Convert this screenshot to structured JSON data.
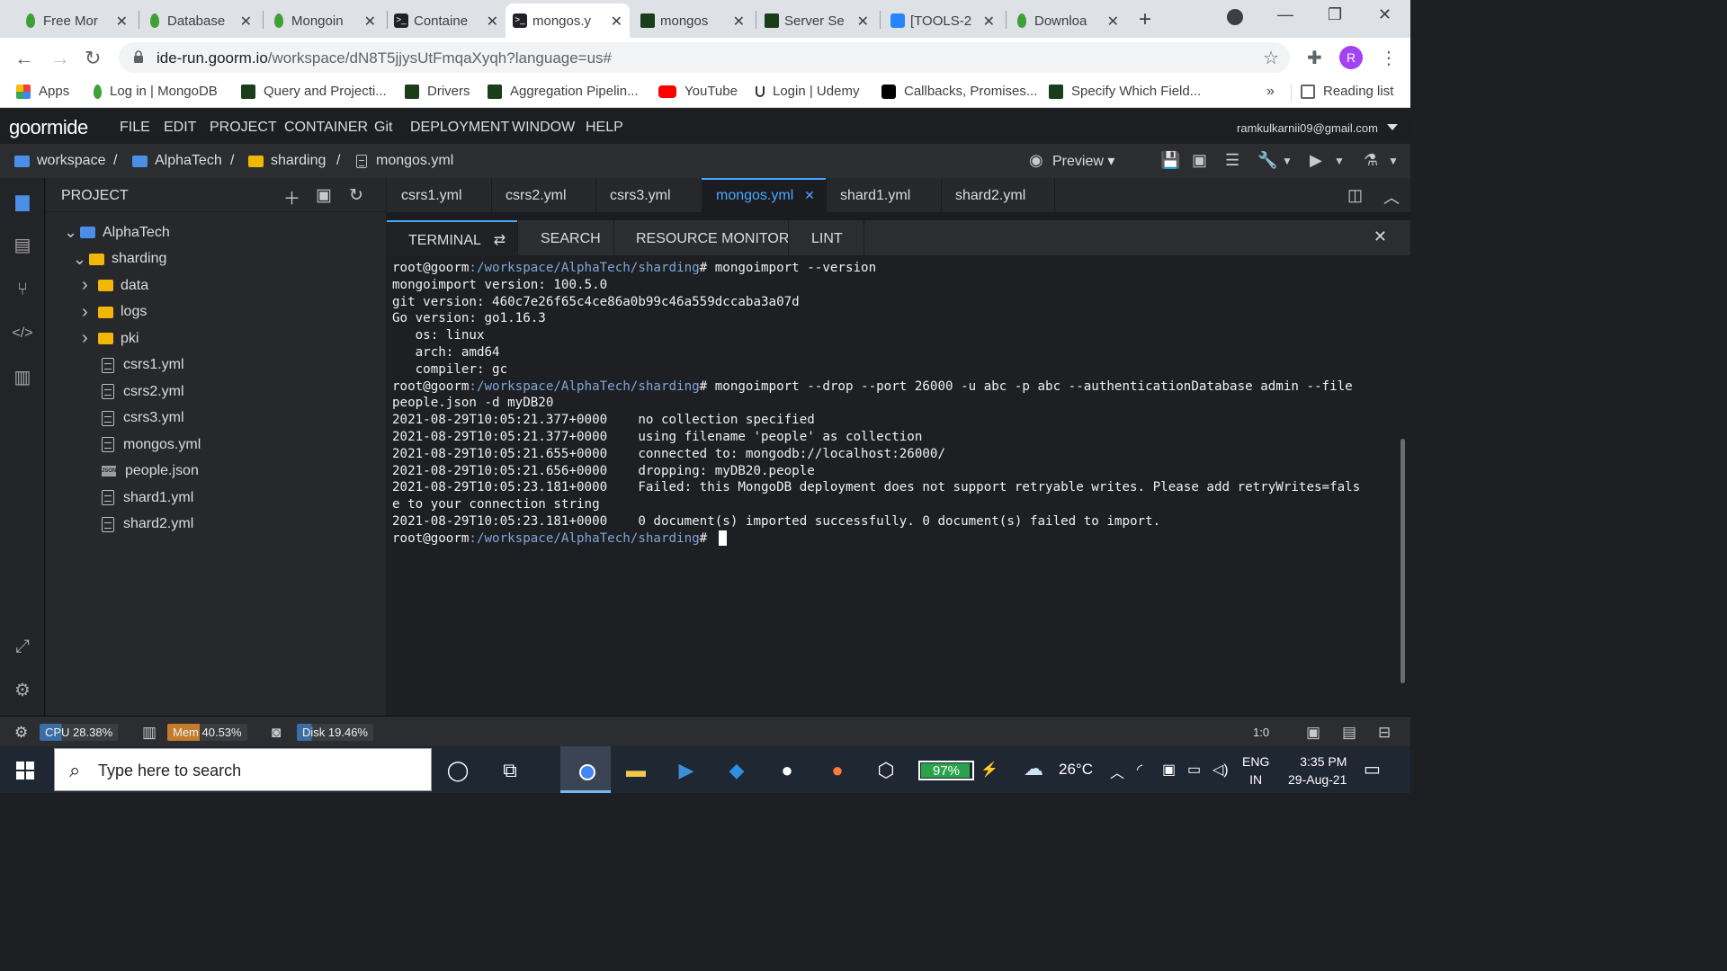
{
  "browser": {
    "tabs": [
      {
        "title": "Free Mor",
        "icon": "mongodb-leaf-icon"
      },
      {
        "title": "Database",
        "icon": "mongodb-leaf-icon"
      },
      {
        "title": "Mongoin",
        "icon": "mongodb-leaf-icon"
      },
      {
        "title": "Containe",
        "icon": "terminal-icon"
      },
      {
        "title": "mongos.y",
        "icon": "terminal-icon",
        "active": true
      },
      {
        "title": "mongos",
        "icon": "mongodb-university-icon"
      },
      {
        "title": "Server Se",
        "icon": "mongodb-university-icon"
      },
      {
        "title": "[TOOLS-2",
        "icon": "jira-icon"
      },
      {
        "title": "Downloa",
        "icon": "mongodb-leaf-icon"
      }
    ],
    "url_host": "ide-run.goorm.io",
    "url_path": "/workspace/dN8T5jjysUtFmqaXyqh?language=us#",
    "profile_initial": "R",
    "bookmarks": [
      {
        "label": "Apps",
        "icon": "apps-icon"
      },
      {
        "label": "Log in | MongoDB",
        "icon": "mongodb-leaf-icon"
      },
      {
        "label": "Query and Projecti...",
        "icon": "mongodb-university-icon"
      },
      {
        "label": "Drivers",
        "icon": "mongodb-university-icon"
      },
      {
        "label": "Aggregation Pipelin...",
        "icon": "mongodb-university-icon"
      },
      {
        "label": "YouTube",
        "icon": "youtube-icon"
      },
      {
        "label": "Login | Udemy",
        "icon": "udemy-icon"
      },
      {
        "label": "Callbacks, Promises...",
        "icon": "medium-icon"
      },
      {
        "label": "Specify Which Field...",
        "icon": "mongodb-university-icon"
      }
    ],
    "more_bookmarks": "»",
    "reading_list": "Reading list"
  },
  "ide": {
    "logo": "goormide",
    "menu": [
      "FILE",
      "EDIT",
      "PROJECT",
      "CONTAINER",
      "Git",
      "DEPLOYMENT",
      "WINDOW",
      "HELP"
    ],
    "user": "ramkulkarnii09@gmail.com",
    "breadcrumb": [
      "workspace",
      "AlphaTech",
      "sharding",
      "mongos.yml"
    ],
    "preview_label": "Preview",
    "project_title": "PROJECT",
    "tree": [
      {
        "label": "AlphaTech",
        "type": "project",
        "depth": 0,
        "expanded": true
      },
      {
        "label": "sharding",
        "type": "folder-open",
        "depth": 1,
        "expanded": true
      },
      {
        "label": "data",
        "type": "folder",
        "depth": 2
      },
      {
        "label": "logs",
        "type": "folder",
        "depth": 2
      },
      {
        "label": "pki",
        "type": "folder",
        "depth": 2
      },
      {
        "label": "csrs1.yml",
        "type": "file",
        "depth": 2
      },
      {
        "label": "csrs2.yml",
        "type": "file",
        "depth": 2
      },
      {
        "label": "csrs3.yml",
        "type": "file",
        "depth": 2
      },
      {
        "label": "mongos.yml",
        "type": "file",
        "depth": 2
      },
      {
        "label": "people.json",
        "type": "json",
        "depth": 2
      },
      {
        "label": "shard1.yml",
        "type": "file",
        "depth": 2
      },
      {
        "label": "shard2.yml",
        "type": "file",
        "depth": 2
      }
    ],
    "editor_tabs": [
      {
        "label": "csrs1.yml"
      },
      {
        "label": "csrs2.yml"
      },
      {
        "label": "csrs3.yml"
      },
      {
        "label": "mongos.yml",
        "active": true
      },
      {
        "label": "shard1.yml"
      },
      {
        "label": "shard2.yml"
      }
    ],
    "panel_tabs": [
      "TERMINAL",
      "SEARCH",
      "RESOURCE MONITOR",
      "LINT"
    ],
    "terminal": {
      "prompt_user": "root@goorm",
      "prompt_path": ":/workspace/AlphaTech/sharding",
      "prompt_sym": "# ",
      "lines": [
        {
          "prompt": true,
          "text": "mongoimport --version"
        },
        {
          "text": "mongoimport version: 100.5.0"
        },
        {
          "text": "git version: 460c7e26f65c4ce86a0b99c46a559dccaba3a07d"
        },
        {
          "text": "Go version: go1.16.3"
        },
        {
          "text": "   os: linux"
        },
        {
          "text": "   arch: amd64"
        },
        {
          "text": "   compiler: gc"
        },
        {
          "prompt": true,
          "text": "mongoimport --drop --port 26000 -u abc -p abc --authenticationDatabase admin --file"
        },
        {
          "text": "people.json -d myDB20"
        },
        {
          "text": "2021-08-29T10:05:21.377+0000    no collection specified"
        },
        {
          "text": "2021-08-29T10:05:21.377+0000    using filename 'people' as collection"
        },
        {
          "text": "2021-08-29T10:05:21.655+0000    connected to: mongodb://localhost:26000/"
        },
        {
          "text": "2021-08-29T10:05:21.656+0000    dropping: myDB20.people"
        },
        {
          "text": "2021-08-29T10:05:23.181+0000    Failed: this MongoDB deployment does not support retryable writes. Please add retryWrites=fals"
        },
        {
          "text": "e to your connection string"
        },
        {
          "text": "2021-08-29T10:05:23.181+0000    0 document(s) imported successfully. 0 document(s) failed to import."
        },
        {
          "prompt": true,
          "text": "",
          "cursor": true
        }
      ]
    },
    "status": {
      "cpu_label": "CPU 28.38%",
      "cpu_percent": 28.38,
      "mem_label": "Mem 40.53%",
      "mem_percent": 40.53,
      "disk_label": "Disk 19.46%",
      "disk_percent": 19.46,
      "cursor_pos": "1:0"
    }
  },
  "taskbar": {
    "search_placeholder": "Type here to search",
    "battery": "97%",
    "battery_percent": 97,
    "temperature": "26°C",
    "lang_1": "ENG",
    "lang_2": "IN",
    "time": "3:35 PM",
    "date": "29-Aug-21"
  },
  "colors": {
    "accent": "#4aa6ff",
    "cpu": "#3a6ea5",
    "mem": "#c27c2c",
    "disk": "#3a6ea5",
    "battery": "#2aa24b"
  }
}
